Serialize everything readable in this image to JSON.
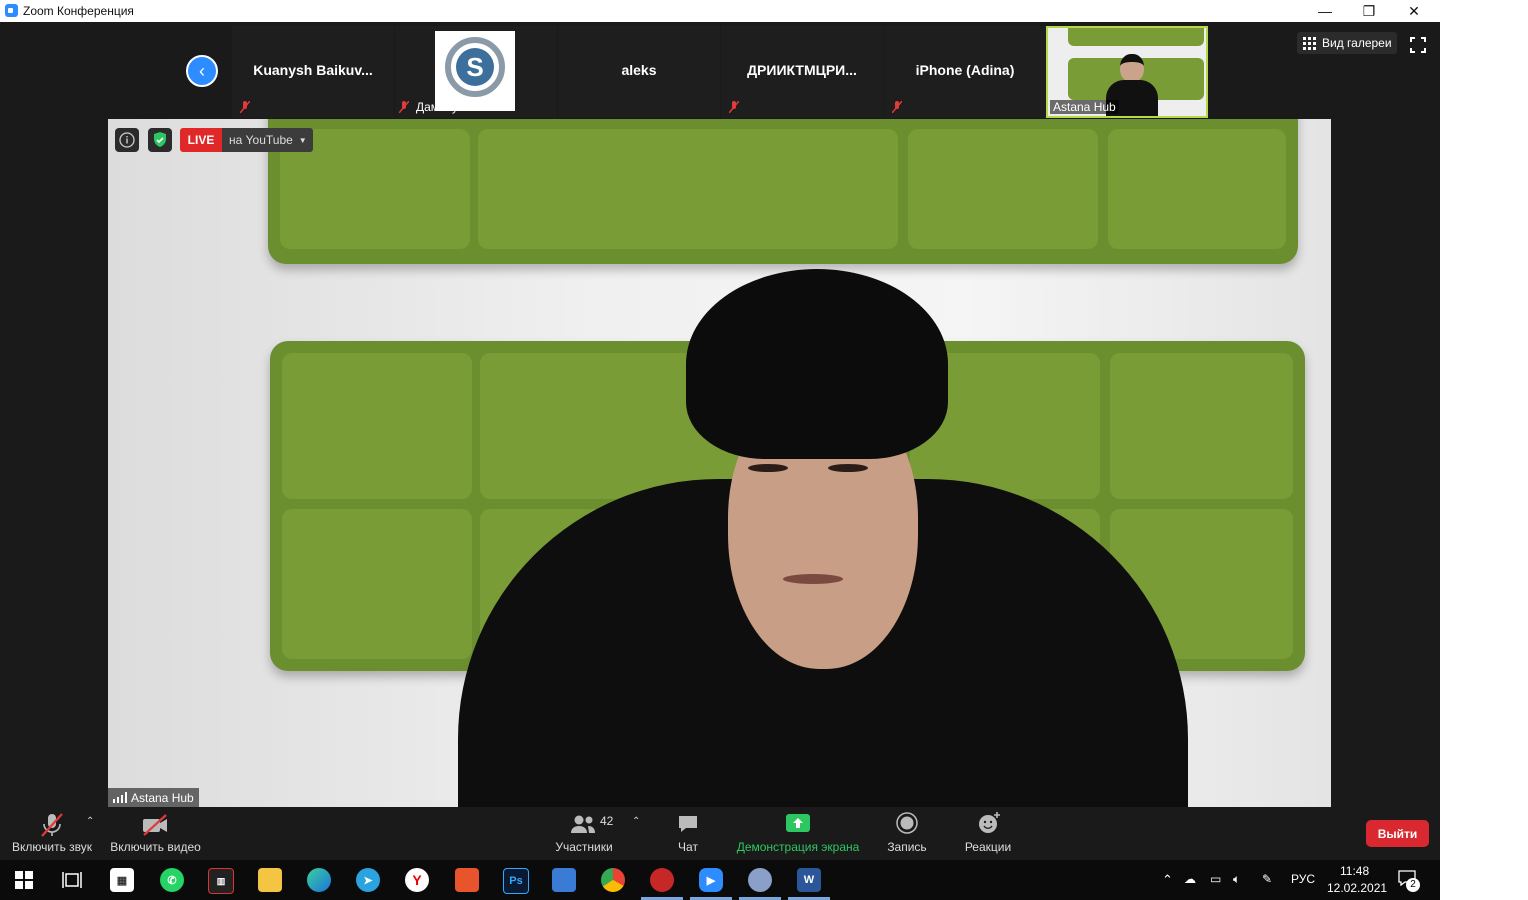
{
  "window": {
    "title": "Zoom Конференция",
    "minimize_glyph": "—",
    "restore_glyph": "❐",
    "close_glyph": "✕"
  },
  "gallery": {
    "back_icon": "chevron-left-icon",
    "tiles": [
      {
        "name": "Kuanysh  Baikuv...",
        "muted": true
      },
      {
        "name": "Дамбаулова...",
        "muted": true,
        "has_logo": true
      },
      {
        "name": "aleks",
        "muted": false
      },
      {
        "name": "ДРИИКТМЦРИ...",
        "muted": true
      },
      {
        "name": "iPhone (Adina)",
        "muted": true
      },
      {
        "name": "Astana Hub",
        "video": true
      }
    ],
    "view_label": "Вид галереи"
  },
  "main": {
    "live_badge": "LIVE",
    "live_target": "на YouTube",
    "speaker_label": "Astana Hub",
    "colors": {
      "panel_green": "#7a9c36",
      "live_red": "#e02828"
    }
  },
  "toolbar": {
    "mic_label": "Включить звук",
    "video_label": "Включить видео",
    "participants_label": "Участники",
    "participants_count": "42",
    "chat_label": "Чат",
    "share_label": "Демонстрация экрана",
    "record_label": "Запись",
    "reactions_label": "Реакции",
    "leave_label": "Выйти",
    "share_color": "#2dc661"
  },
  "taskbar": {
    "apps": [
      "windows-start",
      "task-view",
      "store",
      "whatsapp",
      "audio-app",
      "file-explorer",
      "edge",
      "telegram",
      "yandex",
      "office",
      "photoshop",
      "network-app",
      "chrome",
      "recorder-app",
      "zoom",
      "paint-app",
      "word"
    ],
    "language": "РУС",
    "time": "11:48",
    "date": "12.02.2021",
    "notification_count": "2"
  }
}
